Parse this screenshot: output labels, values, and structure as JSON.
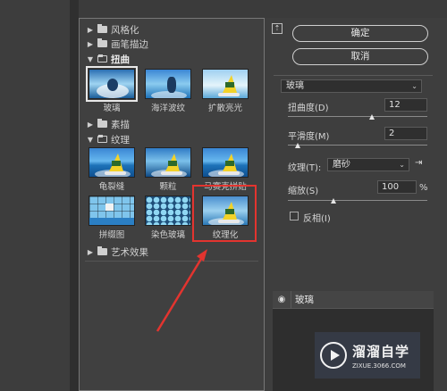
{
  "filter_tree": {
    "categories": [
      {
        "label": "风格化"
      },
      {
        "label": "画笔描边"
      },
      {
        "label": "扭曲"
      },
      {
        "label": "素描"
      },
      {
        "label": "纹理"
      },
      {
        "label": "艺术效果"
      }
    ],
    "distort_filters": [
      "玻璃",
      "海洋波纹",
      "扩散亮光"
    ],
    "texture_filters": [
      "龟裂缝",
      "颗粒",
      "马赛克拼贴",
      "拼缀图",
      "染色玻璃",
      "纹理化"
    ]
  },
  "buttons": {
    "collapse_icon": "up-arrow",
    "ok": "确定",
    "cancel": "取消"
  },
  "params": {
    "filter_select": "玻璃",
    "distortion_label": "扭曲度(D)",
    "distortion_value": "12",
    "distortion_level": 0.6,
    "smoothness_label": "平滑度(M)",
    "smoothness_value": "2",
    "smoothness_level": 0.07,
    "texture_label": "纹理(T):",
    "texture_value": "磨砂",
    "scaling_label": "缩放(S)",
    "scaling_value": "100",
    "scaling_unit": "%",
    "scaling_level": 0.33,
    "invert_label": "反相(I)",
    "invert_checked": false
  },
  "layers": {
    "item": "玻璃"
  },
  "watermark": {
    "title": "溜溜自学",
    "url": "ZIXUE.3066.COM"
  },
  "colors": {
    "annotation_red": "#e3342f",
    "panel_bg": "#3e3e3e"
  }
}
